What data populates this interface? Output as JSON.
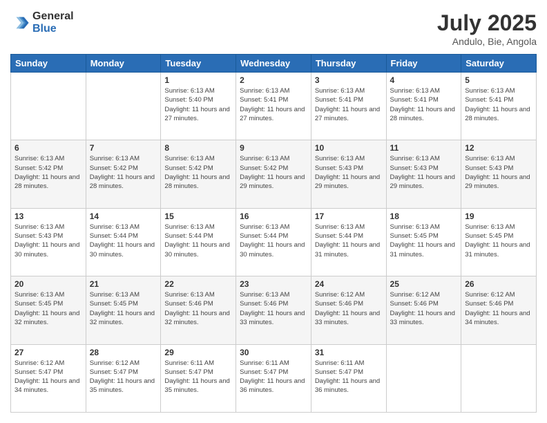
{
  "logo": {
    "general": "General",
    "blue": "Blue"
  },
  "title": "July 2025",
  "subtitle": "Andulo, Bie, Angola",
  "days_of_week": [
    "Sunday",
    "Monday",
    "Tuesday",
    "Wednesday",
    "Thursday",
    "Friday",
    "Saturday"
  ],
  "weeks": [
    [
      {
        "day": "",
        "sunrise": "",
        "sunset": "",
        "daylight": ""
      },
      {
        "day": "",
        "sunrise": "",
        "sunset": "",
        "daylight": ""
      },
      {
        "day": "1",
        "sunrise": "Sunrise: 6:13 AM",
        "sunset": "Sunset: 5:40 PM",
        "daylight": "Daylight: 11 hours and 27 minutes."
      },
      {
        "day": "2",
        "sunrise": "Sunrise: 6:13 AM",
        "sunset": "Sunset: 5:41 PM",
        "daylight": "Daylight: 11 hours and 27 minutes."
      },
      {
        "day": "3",
        "sunrise": "Sunrise: 6:13 AM",
        "sunset": "Sunset: 5:41 PM",
        "daylight": "Daylight: 11 hours and 27 minutes."
      },
      {
        "day": "4",
        "sunrise": "Sunrise: 6:13 AM",
        "sunset": "Sunset: 5:41 PM",
        "daylight": "Daylight: 11 hours and 28 minutes."
      },
      {
        "day": "5",
        "sunrise": "Sunrise: 6:13 AM",
        "sunset": "Sunset: 5:41 PM",
        "daylight": "Daylight: 11 hours and 28 minutes."
      }
    ],
    [
      {
        "day": "6",
        "sunrise": "Sunrise: 6:13 AM",
        "sunset": "Sunset: 5:42 PM",
        "daylight": "Daylight: 11 hours and 28 minutes."
      },
      {
        "day": "7",
        "sunrise": "Sunrise: 6:13 AM",
        "sunset": "Sunset: 5:42 PM",
        "daylight": "Daylight: 11 hours and 28 minutes."
      },
      {
        "day": "8",
        "sunrise": "Sunrise: 6:13 AM",
        "sunset": "Sunset: 5:42 PM",
        "daylight": "Daylight: 11 hours and 28 minutes."
      },
      {
        "day": "9",
        "sunrise": "Sunrise: 6:13 AM",
        "sunset": "Sunset: 5:42 PM",
        "daylight": "Daylight: 11 hours and 29 minutes."
      },
      {
        "day": "10",
        "sunrise": "Sunrise: 6:13 AM",
        "sunset": "Sunset: 5:43 PM",
        "daylight": "Daylight: 11 hours and 29 minutes."
      },
      {
        "day": "11",
        "sunrise": "Sunrise: 6:13 AM",
        "sunset": "Sunset: 5:43 PM",
        "daylight": "Daylight: 11 hours and 29 minutes."
      },
      {
        "day": "12",
        "sunrise": "Sunrise: 6:13 AM",
        "sunset": "Sunset: 5:43 PM",
        "daylight": "Daylight: 11 hours and 29 minutes."
      }
    ],
    [
      {
        "day": "13",
        "sunrise": "Sunrise: 6:13 AM",
        "sunset": "Sunset: 5:43 PM",
        "daylight": "Daylight: 11 hours and 30 minutes."
      },
      {
        "day": "14",
        "sunrise": "Sunrise: 6:13 AM",
        "sunset": "Sunset: 5:44 PM",
        "daylight": "Daylight: 11 hours and 30 minutes."
      },
      {
        "day": "15",
        "sunrise": "Sunrise: 6:13 AM",
        "sunset": "Sunset: 5:44 PM",
        "daylight": "Daylight: 11 hours and 30 minutes."
      },
      {
        "day": "16",
        "sunrise": "Sunrise: 6:13 AM",
        "sunset": "Sunset: 5:44 PM",
        "daylight": "Daylight: 11 hours and 30 minutes."
      },
      {
        "day": "17",
        "sunrise": "Sunrise: 6:13 AM",
        "sunset": "Sunset: 5:44 PM",
        "daylight": "Daylight: 11 hours and 31 minutes."
      },
      {
        "day": "18",
        "sunrise": "Sunrise: 6:13 AM",
        "sunset": "Sunset: 5:45 PM",
        "daylight": "Daylight: 11 hours and 31 minutes."
      },
      {
        "day": "19",
        "sunrise": "Sunrise: 6:13 AM",
        "sunset": "Sunset: 5:45 PM",
        "daylight": "Daylight: 11 hours and 31 minutes."
      }
    ],
    [
      {
        "day": "20",
        "sunrise": "Sunrise: 6:13 AM",
        "sunset": "Sunset: 5:45 PM",
        "daylight": "Daylight: 11 hours and 32 minutes."
      },
      {
        "day": "21",
        "sunrise": "Sunrise: 6:13 AM",
        "sunset": "Sunset: 5:45 PM",
        "daylight": "Daylight: 11 hours and 32 minutes."
      },
      {
        "day": "22",
        "sunrise": "Sunrise: 6:13 AM",
        "sunset": "Sunset: 5:46 PM",
        "daylight": "Daylight: 11 hours and 32 minutes."
      },
      {
        "day": "23",
        "sunrise": "Sunrise: 6:13 AM",
        "sunset": "Sunset: 5:46 PM",
        "daylight": "Daylight: 11 hours and 33 minutes."
      },
      {
        "day": "24",
        "sunrise": "Sunrise: 6:12 AM",
        "sunset": "Sunset: 5:46 PM",
        "daylight": "Daylight: 11 hours and 33 minutes."
      },
      {
        "day": "25",
        "sunrise": "Sunrise: 6:12 AM",
        "sunset": "Sunset: 5:46 PM",
        "daylight": "Daylight: 11 hours and 33 minutes."
      },
      {
        "day": "26",
        "sunrise": "Sunrise: 6:12 AM",
        "sunset": "Sunset: 5:46 PM",
        "daylight": "Daylight: 11 hours and 34 minutes."
      }
    ],
    [
      {
        "day": "27",
        "sunrise": "Sunrise: 6:12 AM",
        "sunset": "Sunset: 5:47 PM",
        "daylight": "Daylight: 11 hours and 34 minutes."
      },
      {
        "day": "28",
        "sunrise": "Sunrise: 6:12 AM",
        "sunset": "Sunset: 5:47 PM",
        "daylight": "Daylight: 11 hours and 35 minutes."
      },
      {
        "day": "29",
        "sunrise": "Sunrise: 6:11 AM",
        "sunset": "Sunset: 5:47 PM",
        "daylight": "Daylight: 11 hours and 35 minutes."
      },
      {
        "day": "30",
        "sunrise": "Sunrise: 6:11 AM",
        "sunset": "Sunset: 5:47 PM",
        "daylight": "Daylight: 11 hours and 36 minutes."
      },
      {
        "day": "31",
        "sunrise": "Sunrise: 6:11 AM",
        "sunset": "Sunset: 5:47 PM",
        "daylight": "Daylight: 11 hours and 36 minutes."
      },
      {
        "day": "",
        "sunrise": "",
        "sunset": "",
        "daylight": ""
      },
      {
        "day": "",
        "sunrise": "",
        "sunset": "",
        "daylight": ""
      }
    ]
  ]
}
